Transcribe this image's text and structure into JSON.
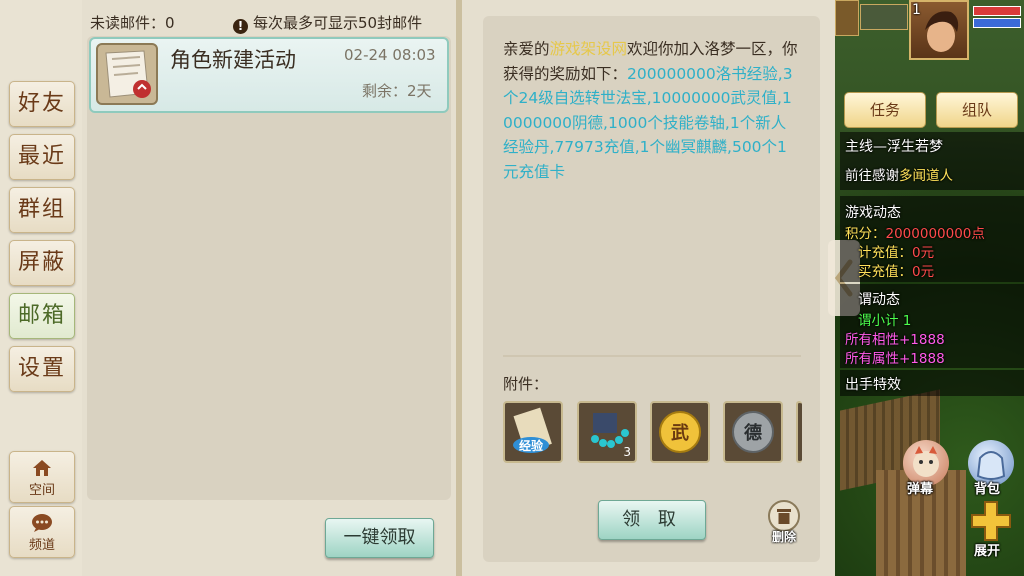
{
  "nav": {
    "items": [
      "好友",
      "最近",
      "群组",
      "屏蔽",
      "邮箱",
      "设置"
    ],
    "space_label": "空间",
    "channel_label": "频道"
  },
  "mail_list": {
    "unread_label": "未读邮件：0",
    "notice": "每次最多可显示50封邮件",
    "notice_icon": "exclamation-icon",
    "items": [
      {
        "subject": "角色新建活动",
        "date": "02-24 08:03",
        "remaining": "剩余：2天",
        "icon": "letter-icon"
      }
    ],
    "claim_all_label": "一键领取"
  },
  "mail_detail": {
    "greeting": "亲爱的",
    "site_name": "游戏架设网",
    "welcome": "欢迎你加入洛梦一区，你获得的奖励如下：",
    "rewards_text": "200000000洛书经验,3个24级自选转世法宝,10000000武灵值,10000000阴德,1000个技能卷轴,1个新人经验丹,77973充值,1个幽冥麒麟,500个1元充值卡",
    "attachments_label": "附件：",
    "attachments": [
      {
        "icon": "exp-scroll-icon",
        "label": "经验",
        "count": ""
      },
      {
        "icon": "beads-icon",
        "label": "",
        "count": "3"
      },
      {
        "icon": "martial-coin-icon",
        "label": "武",
        "count": ""
      },
      {
        "icon": "virtue-coin-icon",
        "label": "德",
        "count": ""
      }
    ],
    "claim_label": "领 取",
    "delete_label": "删除"
  },
  "hud": {
    "level": "1",
    "task_label": "任务",
    "team_label": "组队",
    "quest_title": "主线—浮生若梦",
    "quest_prefix": "前往感谢",
    "quest_npc": "多闻道人",
    "game_dynamic_title": "游戏动态",
    "score_prefix": "积分：",
    "score_value": "2000000000点",
    "recharge_total": "计充值：",
    "recharge_total_value": "0元",
    "recharge_buy": "买充值：",
    "recharge_buy_value": "0元",
    "title_dynamic": "谓动态",
    "subtotal": "谓小计 1",
    "all_phase": "所有相性+1888",
    "all_attr": "所有属性+1888",
    "special": "出手特效",
    "barrage_label": "弹幕",
    "bag_label": "背包",
    "expand_label": "展开",
    "colors": {
      "yellow": "#ffe25a",
      "green": "#4dff4d",
      "pink": "#ff5be8",
      "red": "#ff4b4b"
    }
  }
}
